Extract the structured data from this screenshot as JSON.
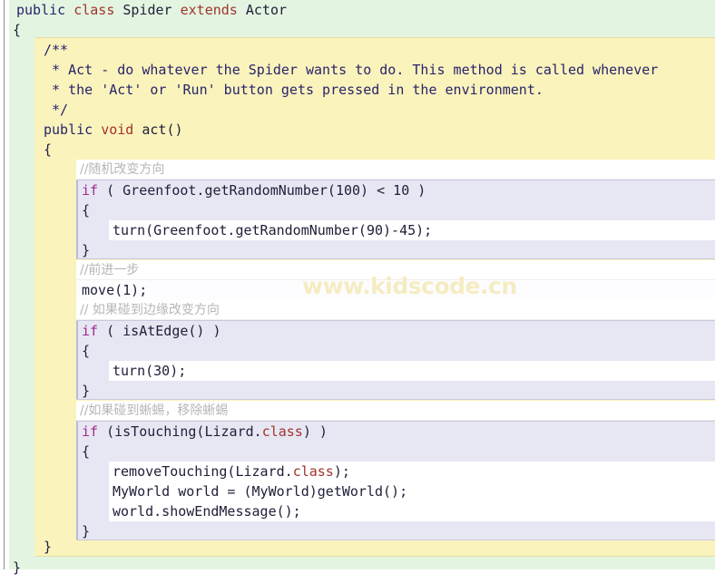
{
  "editor": {
    "kind": "greenfoot-stride-code-editor",
    "watermark": "www.kidscode.cn",
    "colors": {
      "class_frame": "#e3f5e1",
      "method_frame": "#fbf3bc",
      "block_frame": "#e7e7f4",
      "slot": "#ffffff",
      "comment_text": "#b6b6b6",
      "keyword": "#a0342c",
      "modifier": "#27246b",
      "if_keyword": "#a02a8c",
      "watermark": "#f6ecc2"
    }
  },
  "code": {
    "class_header": {
      "modifier": "public",
      "keyword_class": "class",
      "name": "Spider",
      "keyword_extends": "extends",
      "superclass": "Actor"
    },
    "class_open_brace": "{",
    "class_close_brace": "}",
    "javadoc": [
      "/**",
      " * Act - do whatever the Spider wants to do. This method is called whenever",
      " * the 'Act' or 'Run' button gets pressed in the environment.",
      " */"
    ],
    "method_signature": {
      "modifier": "public",
      "return_type": "void",
      "name_and_params": "act()"
    },
    "method_open_brace": "{",
    "method_close_brace": "}",
    "blocks": [
      {
        "comment": "//随机改变方向",
        "header_keyword": "if",
        "header_rest": " ( Greenfoot.getRandomNumber(100) < 10 )",
        "open_brace": "{",
        "statements": [
          "turn(Greenfoot.getRandomNumber(90)-45);"
        ],
        "close_brace": "}"
      },
      {
        "comment": "//前进一步",
        "statement_only": "move(1);"
      },
      {
        "comment": "// 如果碰到边缘改变方向",
        "header_keyword": "if",
        "header_rest": " ( isAtEdge() )",
        "open_brace": "{",
        "statements": [
          "turn(30);"
        ],
        "close_brace": "}"
      },
      {
        "comment": "//如果碰到蜥蜴，移除蜥蜴",
        "header_keyword": "if",
        "header_prefix": " (isTouching(Lizard.",
        "header_class_kw": "class",
        "header_suffix": ") )",
        "open_brace": "{",
        "statements": [
          "removeTouching(Lizard.class);",
          "MyWorld world = (MyWorld)getWorld();",
          "world.showEndMessage();"
        ],
        "close_brace": "}"
      }
    ]
  }
}
